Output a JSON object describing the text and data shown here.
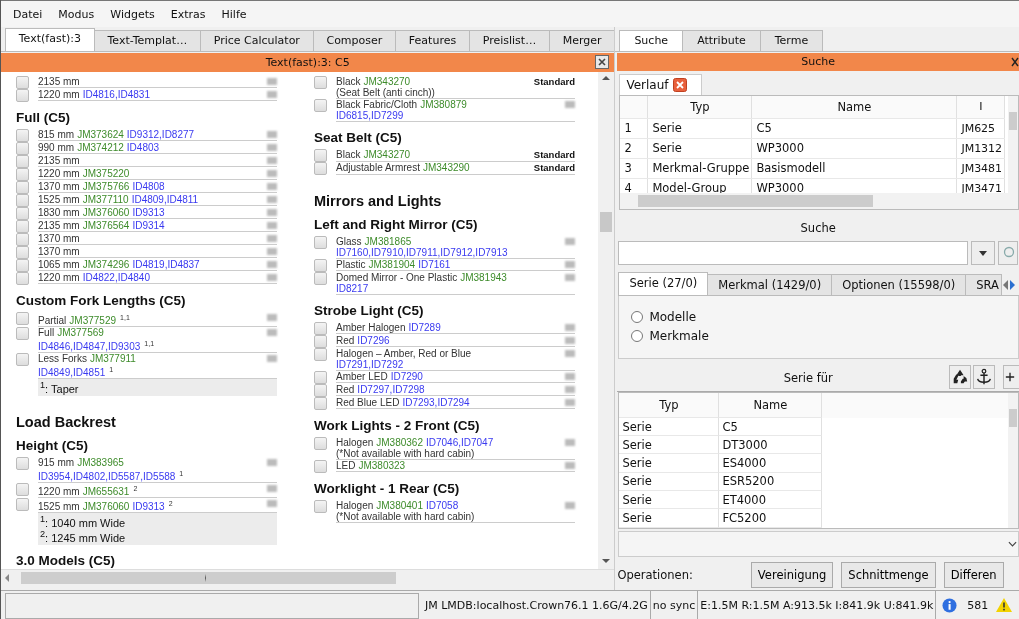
{
  "menu": [
    "Datei",
    "Modus",
    "Widgets",
    "Extras",
    "Hilfe"
  ],
  "tabs": [
    {
      "label": "Text(fast):3",
      "selected": true
    },
    {
      "label": "Text-Templat…",
      "selected": false
    },
    {
      "label": "Price Calculator",
      "selected": false
    },
    {
      "label": "Composer",
      "selected": false
    },
    {
      "label": "Features",
      "selected": false
    },
    {
      "label": "Preislist…",
      "selected": false
    },
    {
      "label": "Merger",
      "selected": false
    }
  ],
  "doc": {
    "title": "Text(fast):3: C5",
    "columns": [
      [
        {
          "kind": "option",
          "checked": false,
          "lines": [
            [
              {
                "kind": "text",
                "text": "2135 mm"
              }
            ]
          ]
        },
        {
          "kind": "option",
          "checked": false,
          "lines": [
            [
              {
                "kind": "text",
                "text": "1220 mm"
              },
              {
                "kind": "id",
                "text": "ID4816,ID4831"
              }
            ]
          ]
        },
        {
          "kind": "heading",
          "text": "Full (C5)"
        },
        {
          "kind": "option",
          "checked": false,
          "lines": [
            [
              {
                "kind": "text",
                "text": "815 mm"
              },
              {
                "kind": "jm",
                "text": "JM373624"
              },
              {
                "kind": "id",
                "text": "ID9312,ID8277"
              }
            ]
          ]
        },
        {
          "kind": "option",
          "checked": false,
          "lines": [
            [
              {
                "kind": "text",
                "text": "990 mm"
              },
              {
                "kind": "jm",
                "text": "JM374212"
              },
              {
                "kind": "id",
                "text": "ID4803"
              }
            ]
          ]
        },
        {
          "kind": "option",
          "checked": false,
          "lines": [
            [
              {
                "kind": "text",
                "text": "2135 mm"
              }
            ]
          ]
        },
        {
          "kind": "option",
          "checked": false,
          "lines": [
            [
              {
                "kind": "text",
                "text": "1220 mm"
              },
              {
                "kind": "jm",
                "text": "JM375220"
              }
            ]
          ]
        },
        {
          "kind": "option",
          "checked": false,
          "lines": [
            [
              {
                "kind": "text",
                "text": "1370 mm"
              },
              {
                "kind": "jm",
                "text": "JM375766"
              },
              {
                "kind": "id",
                "text": "ID4808"
              }
            ]
          ]
        },
        {
          "kind": "option",
          "checked": false,
          "lines": [
            [
              {
                "kind": "text",
                "text": "1525 mm"
              },
              {
                "kind": "jm",
                "text": "JM377110"
              },
              {
                "kind": "id",
                "text": "ID4809,ID4811"
              }
            ]
          ]
        },
        {
          "kind": "option",
          "checked": false,
          "lines": [
            [
              {
                "kind": "text",
                "text": "1830 mm"
              },
              {
                "kind": "jm",
                "text": "JM376060"
              },
              {
                "kind": "id",
                "text": "ID9313"
              }
            ]
          ]
        },
        {
          "kind": "option",
          "checked": false,
          "lines": [
            [
              {
                "kind": "text",
                "text": "2135 mm"
              },
              {
                "kind": "jm",
                "text": "JM376564"
              },
              {
                "kind": "id",
                "text": "ID9314"
              }
            ]
          ]
        },
        {
          "kind": "option",
          "checked": false,
          "lines": [
            [
              {
                "kind": "text",
                "text": "1370 mm"
              }
            ]
          ]
        },
        {
          "kind": "option",
          "checked": false,
          "lines": [
            [
              {
                "kind": "text",
                "text": "1370 mm"
              }
            ]
          ]
        },
        {
          "kind": "option",
          "checked": false,
          "lines": [
            [
              {
                "kind": "text",
                "text": "1065 mm"
              },
              {
                "kind": "jm",
                "text": "JM374296"
              },
              {
                "kind": "id",
                "text": "ID4819,ID4837"
              }
            ]
          ]
        },
        {
          "kind": "option",
          "checked": false,
          "lines": [
            [
              {
                "kind": "text",
                "text": "1220 mm"
              },
              {
                "kind": "id",
                "text": "ID4822,ID4840"
              }
            ]
          ]
        },
        {
          "kind": "heading",
          "text": "Custom Fork Lengths (C5)"
        },
        {
          "kind": "option",
          "checked": false,
          "lines": [
            [
              {
                "kind": "text",
                "text": "Partial"
              },
              {
                "kind": "jm",
                "text": "JM377529"
              },
              {
                "kind": "sup",
                "text": "1,1"
              }
            ]
          ]
        },
        {
          "kind": "option",
          "checked": false,
          "lines": [
            [
              {
                "kind": "text",
                "text": "Full"
              },
              {
                "kind": "jm",
                "text": "JM377569"
              }
            ],
            [
              {
                "kind": "id",
                "text": "ID4846,ID4847,ID9303"
              },
              {
                "kind": "sup",
                "text": "1,1"
              }
            ]
          ]
        },
        {
          "kind": "option",
          "checked": false,
          "lines": [
            [
              {
                "kind": "text",
                "text": "Less Forks"
              },
              {
                "kind": "jm",
                "text": "JM377911"
              }
            ],
            [
              {
                "kind": "id",
                "text": "ID4849,ID4851"
              },
              {
                "kind": "sup",
                "text": "1"
              }
            ]
          ]
        },
        {
          "kind": "notes",
          "lines": [
            "$^{1}$: Taper"
          ]
        },
        {
          "kind": "title",
          "text": "Load Backrest"
        },
        {
          "kind": "heading",
          "text": "Height (C5)"
        },
        {
          "kind": "option",
          "checked": false,
          "lines": [
            [
              {
                "kind": "text",
                "text": "915 mm"
              },
              {
                "kind": "jm",
                "text": "JM383965"
              }
            ],
            [
              {
                "kind": "id",
                "text": "ID3954,ID4802,ID5587,ID5588"
              },
              {
                "kind": "sup",
                "text": "1"
              }
            ]
          ]
        },
        {
          "kind": "option",
          "checked": false,
          "lines": [
            [
              {
                "kind": "text",
                "text": "1220 mm"
              },
              {
                "kind": "jm",
                "text": "JM655631"
              },
              {
                "kind": "sup",
                "text": "2"
              }
            ]
          ]
        },
        {
          "kind": "option",
          "checked": false,
          "lines": [
            [
              {
                "kind": "text",
                "text": "1525 mm"
              },
              {
                "kind": "jm",
                "text": "JM376060"
              },
              {
                "kind": "id",
                "text": "ID9313"
              },
              {
                "kind": "sup",
                "text": "2"
              }
            ]
          ]
        },
        {
          "kind": "notes",
          "lines": [
            "$^{1}$: 1040 mm Wide",
            "$^{2}$: 1245 mm Wide"
          ]
        },
        {
          "kind": "heading",
          "text": "3.0 Models (C5)"
        }
      ],
      [
        {
          "kind": "option",
          "checked": false,
          "tag": "Standard",
          "lines": [
            [
              {
                "kind": "text",
                "text": "Black"
              },
              {
                "kind": "jm",
                "text": "JM343270"
              }
            ],
            [
              {
                "kind": "text",
                "text": "(Seat Belt (anti cinch))"
              }
            ]
          ]
        },
        {
          "kind": "option",
          "checked": false,
          "lines": [
            [
              {
                "kind": "text",
                "text": "Black Fabric/Cloth"
              },
              {
                "kind": "jm",
                "text": "JM380879"
              }
            ],
            [
              {
                "kind": "id",
                "text": "ID6815,ID7299"
              }
            ]
          ]
        },
        {
          "kind": "heading",
          "text": "Seat Belt (C5)"
        },
        {
          "kind": "option",
          "checked": false,
          "tag": "Standard",
          "lines": [
            [
              {
                "kind": "text",
                "text": "Black"
              },
              {
                "kind": "jm",
                "text": "JM343270"
              }
            ]
          ]
        },
        {
          "kind": "option",
          "checked": false,
          "tag": "Standard",
          "lines": [
            [
              {
                "kind": "text",
                "text": "Adjustable Armrest"
              },
              {
                "kind": "jm",
                "text": "JM343290"
              }
            ]
          ]
        },
        {
          "kind": "title",
          "text": "Mirrors and Lights"
        },
        {
          "kind": "heading",
          "text": "Left and Right Mirror (C5)"
        },
        {
          "kind": "option",
          "checked": false,
          "lines": [
            [
              {
                "kind": "text",
                "text": "Glass"
              },
              {
                "kind": "jm",
                "text": "JM381865"
              }
            ],
            [
              {
                "kind": "id",
                "text": "ID7160,ID7910,ID7911,ID7912,ID7913"
              }
            ]
          ]
        },
        {
          "kind": "option",
          "checked": false,
          "lines": [
            [
              {
                "kind": "text",
                "text": "Plastic"
              },
              {
                "kind": "jm",
                "text": "JM381904"
              },
              {
                "kind": "id",
                "text": "ID7161"
              }
            ]
          ]
        },
        {
          "kind": "option",
          "checked": false,
          "lines": [
            [
              {
                "kind": "text",
                "text": "Domed Mirror - One Plastic"
              },
              {
                "kind": "jm",
                "text": "JM381943"
              }
            ],
            [
              {
                "kind": "id",
                "text": "ID8217"
              }
            ]
          ]
        },
        {
          "kind": "heading",
          "text": "Strobe Light (C5)"
        },
        {
          "kind": "option",
          "checked": false,
          "lines": [
            [
              {
                "kind": "text",
                "text": "Amber Halogen"
              },
              {
                "kind": "id",
                "text": "ID7289"
              }
            ]
          ]
        },
        {
          "kind": "option",
          "checked": false,
          "lines": [
            [
              {
                "kind": "text",
                "text": "Red"
              },
              {
                "kind": "id",
                "text": "ID7296"
              }
            ]
          ]
        },
        {
          "kind": "option",
          "checked": false,
          "lines": [
            [
              {
                "kind": "text",
                "text": "Halogen – Amber, Red or Blue"
              }
            ],
            [
              {
                "kind": "id",
                "text": "ID7291,ID7292"
              }
            ]
          ]
        },
        {
          "kind": "option",
          "checked": false,
          "lines": [
            [
              {
                "kind": "text",
                "text": "Amber LED"
              },
              {
                "kind": "id",
                "text": "ID7290"
              }
            ]
          ]
        },
        {
          "kind": "option",
          "checked": false,
          "lines": [
            [
              {
                "kind": "text",
                "text": "Red"
              },
              {
                "kind": "id",
                "text": "ID7297,ID7298"
              }
            ]
          ]
        },
        {
          "kind": "option",
          "checked": false,
          "lines": [
            [
              {
                "kind": "text",
                "text": "Red Blue LED"
              },
              {
                "kind": "id",
                "text": "ID7293,ID7294"
              }
            ]
          ]
        },
        {
          "kind": "heading",
          "text": "Work Lights - 2 Front (C5)"
        },
        {
          "kind": "option",
          "checked": false,
          "lines": [
            [
              {
                "kind": "text",
                "text": "Halogen"
              },
              {
                "kind": "jm",
                "text": "JM380362"
              },
              {
                "kind": "id",
                "text": "ID7046,ID7047"
              }
            ],
            [
              {
                "kind": "text",
                "text": "(*Not available with hard cabin)"
              }
            ]
          ]
        },
        {
          "kind": "option",
          "checked": false,
          "lines": [
            [
              {
                "kind": "text",
                "text": "LED"
              },
              {
                "kind": "jm",
                "text": "JM380323"
              }
            ]
          ]
        },
        {
          "kind": "heading",
          "text": "Worklight - 1 Rear (C5)"
        },
        {
          "kind": "option",
          "checked": false,
          "lines": [
            [
              {
                "kind": "text",
                "text": "Halogen"
              },
              {
                "kind": "jm",
                "text": "JM380401"
              },
              {
                "kind": "id",
                "text": "ID7058"
              }
            ],
            [
              {
                "kind": "text",
                "text": "(*Not available with hard cabin)"
              }
            ]
          ]
        }
      ]
    ]
  },
  "right": {
    "tabs": [
      {
        "label": "Suche",
        "selected": true
      },
      {
        "label": "Attribute",
        "selected": false
      },
      {
        "label": "Terme",
        "selected": false
      }
    ],
    "panel_title": "Suche",
    "history_tab": "Verlauf",
    "history": {
      "columns": [
        "",
        "Typ",
        "Name",
        "I"
      ],
      "rows": [
        [
          "1",
          "Serie",
          "C5",
          "JM625"
        ],
        [
          "2",
          "Serie",
          "WP3000",
          "JM1312"
        ],
        [
          "3",
          "Merkmal-Gruppe",
          "Basismodell",
          "JM3481"
        ],
        [
          "4",
          "Model-Group",
          "WP3000",
          "JM3471"
        ]
      ]
    },
    "search_title": "Suche",
    "result_tabs": [
      {
        "label": "Serie (27/0)",
        "selected": true
      },
      {
        "label": "Merkmal (1429/0)",
        "selected": false
      },
      {
        "label": "Optionen (15598/0)",
        "selected": false
      },
      {
        "label": "SRA",
        "selected": false
      }
    ],
    "radios": [
      {
        "label": "Modelle",
        "selected": false
      },
      {
        "label": "Merkmale",
        "selected": false
      }
    ],
    "series_for": {
      "title": "Serie für",
      "columns": [
        "Typ",
        "Name"
      ],
      "rows": [
        [
          "Serie",
          "C5"
        ],
        [
          "Serie",
          "DT3000"
        ],
        [
          "Serie",
          "ES4000"
        ],
        [
          "Serie",
          "ESR5200"
        ],
        [
          "Serie",
          "ET4000"
        ],
        [
          "Serie",
          "FC5200"
        ]
      ]
    },
    "operations": {
      "label": "Operationen:",
      "buttons": [
        "Vereinigung",
        "Schnittmenge",
        "Differen"
      ]
    }
  },
  "status": {
    "segments": [
      "JM LMDB:localhost.Crown76.1 1.6G/4.2G",
      "no sync",
      "E:1.5M R:1.5M A:913.5k I:841.9k U:841.9k"
    ],
    "count": "581"
  }
}
